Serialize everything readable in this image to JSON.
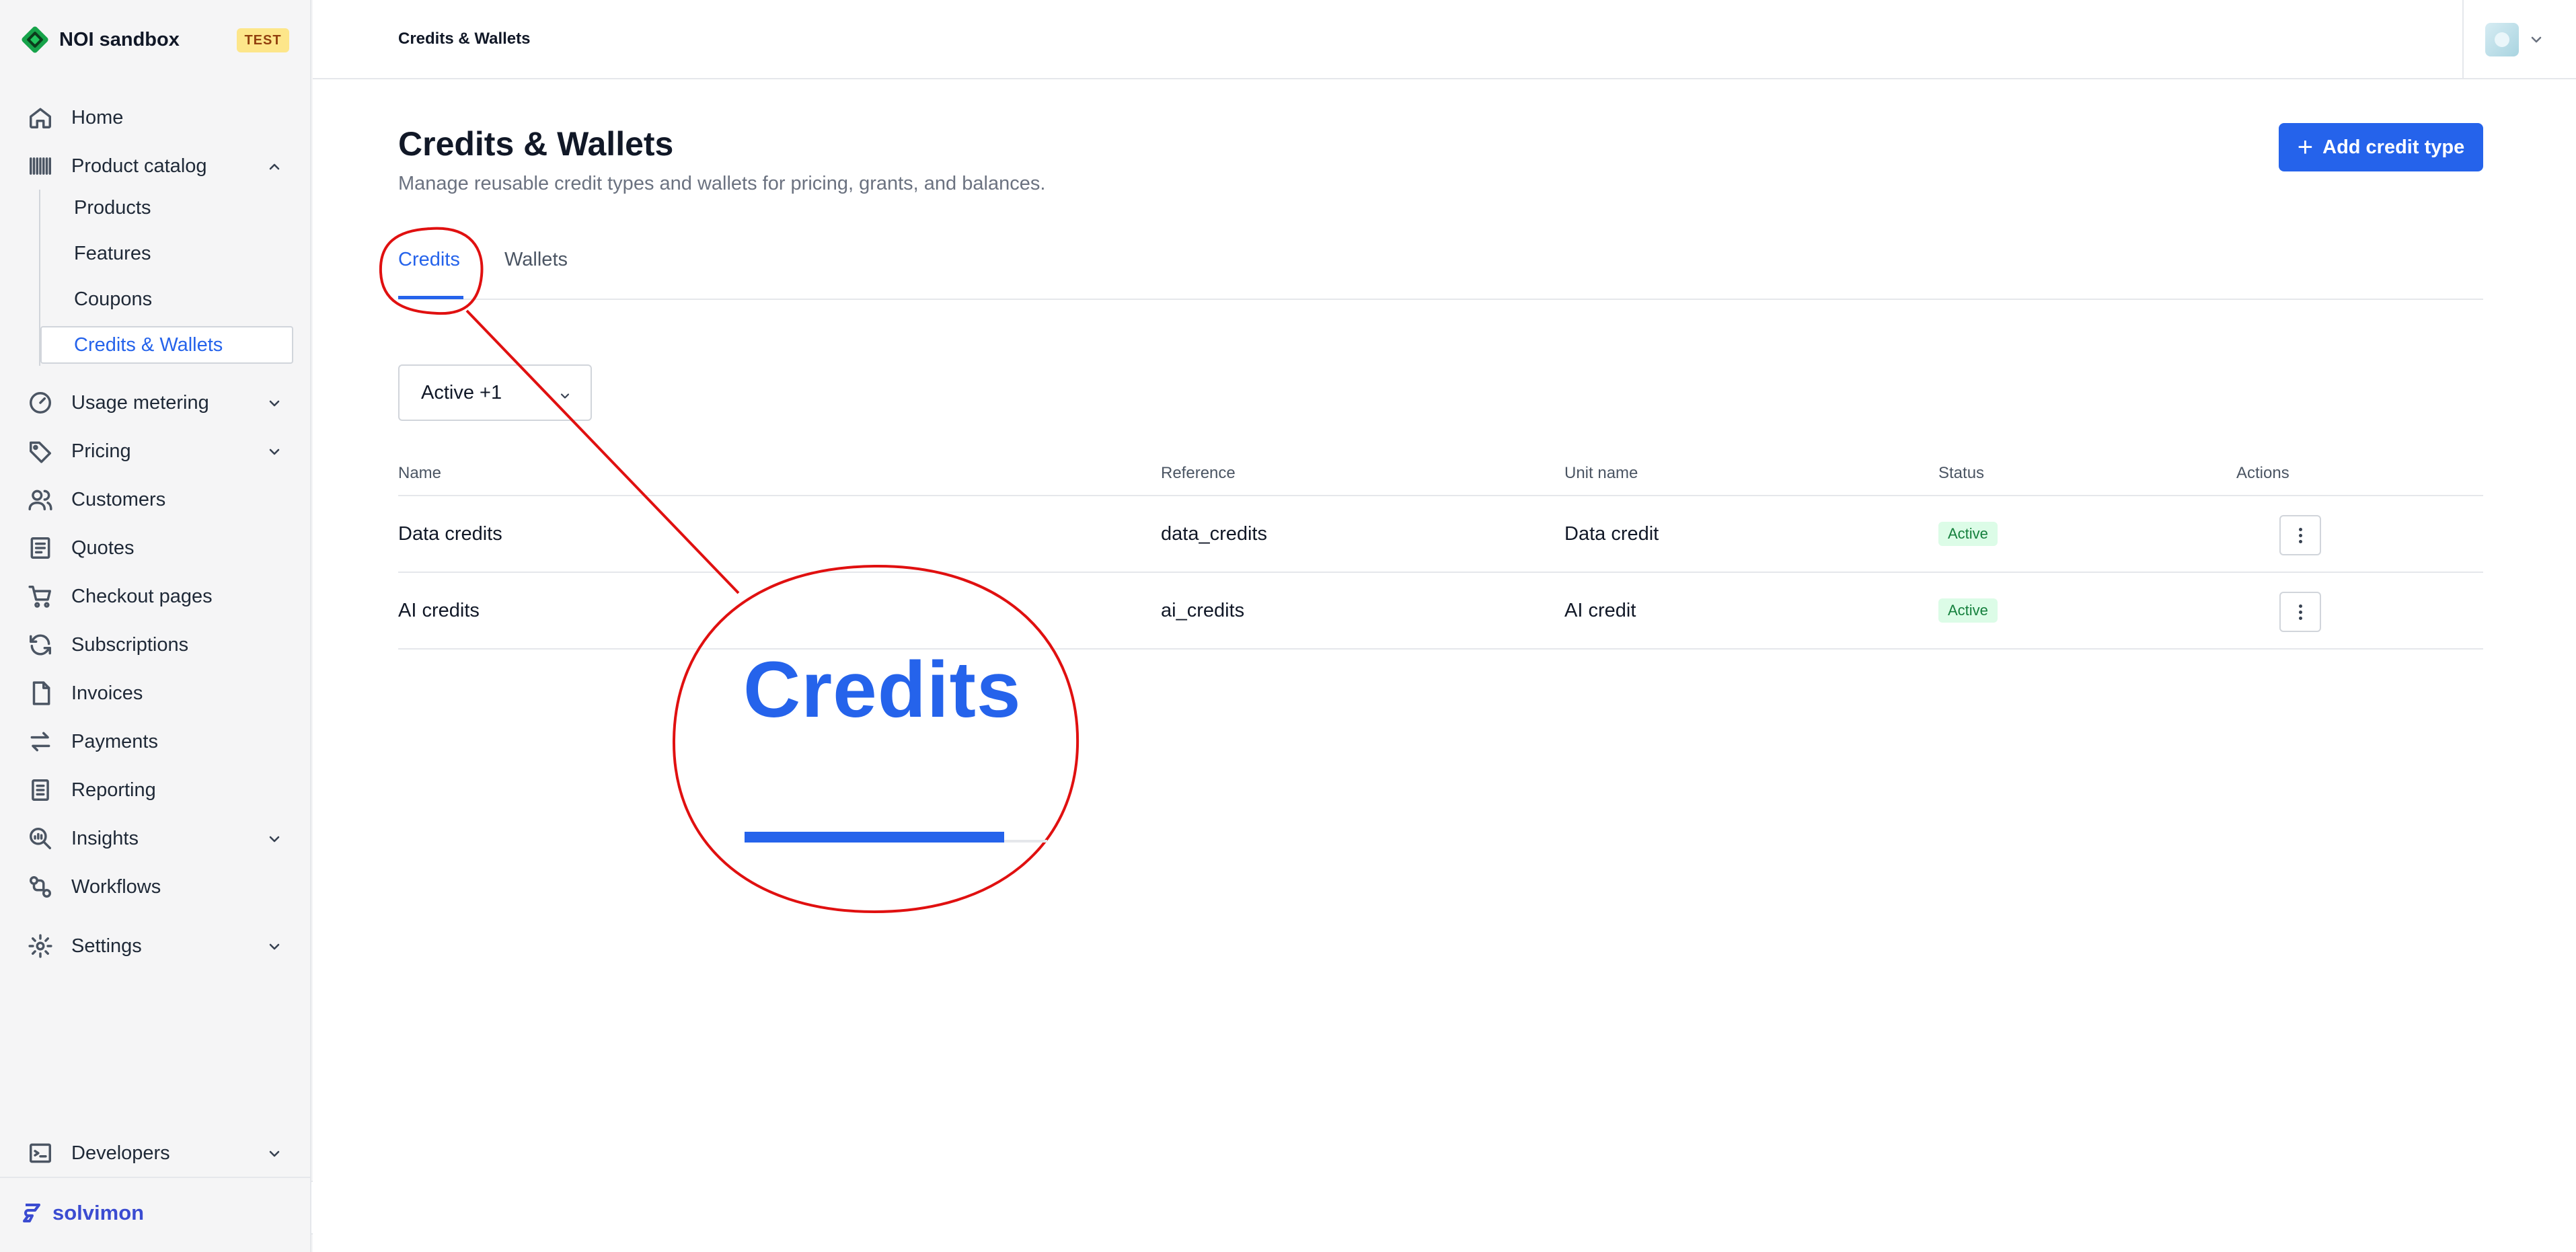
{
  "app": {
    "workspace_name": "NOI sandbox",
    "env_badge": "TEST",
    "footer_brand": "solvimon"
  },
  "sidebar": {
    "home": "Home",
    "product_catalog": "Product catalog",
    "product_catalog_children": [
      "Products",
      "Features",
      "Coupons",
      "Credits & Wallets"
    ],
    "usage_metering": "Usage metering",
    "pricing": "Pricing",
    "customers": "Customers",
    "quotes": "Quotes",
    "checkout_pages": "Checkout pages",
    "subscriptions": "Subscriptions",
    "invoices": "Invoices",
    "payments": "Payments",
    "reporting": "Reporting",
    "insights": "Insights",
    "workflows": "Workflows",
    "settings": "Settings",
    "developers": "Developers"
  },
  "topbar": {
    "breadcrumb": "Credits & Wallets"
  },
  "page": {
    "title": "Credits & Wallets",
    "subtitle": "Manage reusable credit types and wallets for pricing, grants, and balances.",
    "primary_action": "Add credit type",
    "tabs": [
      "Credits",
      "Wallets"
    ],
    "active_tab": "Credits",
    "filter_label": "Active +1"
  },
  "table": {
    "columns": [
      "Name",
      "Reference",
      "Unit name",
      "Status",
      "Actions"
    ],
    "rows": [
      {
        "name": "Data credits",
        "reference": "data_credits",
        "unit_name": "Data credit",
        "status": "Active"
      },
      {
        "name": "AI credits",
        "reference": "ai_credits",
        "unit_name": "AI credit",
        "status": "Active"
      }
    ]
  },
  "annotation": {
    "zoom_label": "Credits",
    "color": "#e01010"
  },
  "colors": {
    "accent": "#2563eb",
    "status_active_bg": "#dcfce7",
    "status_active_text": "#15803d",
    "test_badge": "#fde68a"
  }
}
